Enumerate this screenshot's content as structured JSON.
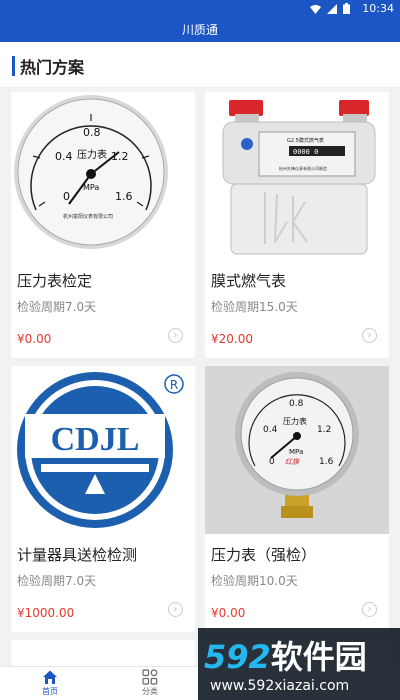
{
  "status": {
    "time": "10:34"
  },
  "appbar": {
    "title": "川质通"
  },
  "section": {
    "title": "热门方案"
  },
  "cards": [
    {
      "name": "压力表检定",
      "period": "检验周期7.0天",
      "price": "¥0.00"
    },
    {
      "name": "膜式燃气表",
      "period": "检验周期15.0天",
      "price": "¥20.00"
    },
    {
      "name": "计量器具送检检测",
      "period": "检验周期7.0天",
      "price": "¥1000.00"
    },
    {
      "name": "压力表（强检）",
      "period": "检验周期10.0天",
      "price": "¥0.00"
    }
  ],
  "gauge1": {
    "ticks": [
      "0",
      "0.4",
      "0.8",
      "1.2",
      "1.6"
    ],
    "label": "压力表",
    "unit": "MPa",
    "maker": "杭州富阳仪表有限公司"
  },
  "gasmeter": {
    "model": "G2.5膜式燃气表",
    "reading": "0000 0",
    "maker": "杭州先锋仪表有限公司制造"
  },
  "cdjl": {
    "text": "CDJL",
    "mark": "R"
  },
  "gauge2": {
    "ticks": [
      "0",
      "0.4",
      "0.8",
      "1.2",
      "1.6"
    ],
    "label": "压力表",
    "unit": "MPa",
    "maker": "红旗"
  },
  "tabs": [
    {
      "label": "首页",
      "icon": "home-icon",
      "active": true
    },
    {
      "label": "分类",
      "icon": "grid-icon",
      "active": false
    }
  ],
  "watermark": {
    "brand_num": "592",
    "brand_text": "软件园",
    "url": "www.592xiazai.com"
  },
  "colors": {
    "primary": "#1b56c4",
    "price": "#e23b2e"
  }
}
